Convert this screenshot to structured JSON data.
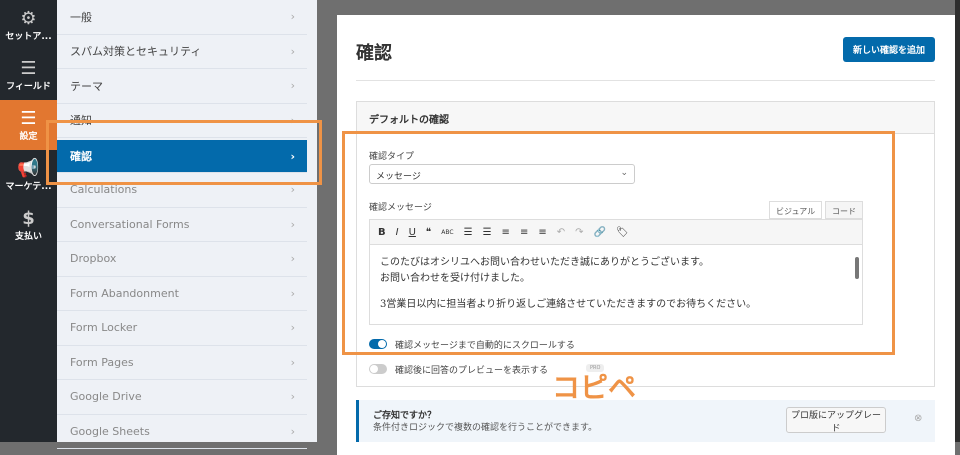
{
  "nav": [
    {
      "label": "セットア...",
      "icon": "gear-icon"
    },
    {
      "label": "フィールド",
      "icon": "fields-icon"
    },
    {
      "label": "設定",
      "icon": "sliders-icon",
      "active": true
    },
    {
      "label": "マーケテ...",
      "icon": "megaphone-icon"
    },
    {
      "label": "支払い",
      "icon": "dollar-icon"
    }
  ],
  "submenu": [
    "一般",
    "スパム対策とセキュリティ",
    "テーマ",
    "通知",
    "確認",
    "Calculations",
    "Conversational Forms",
    "Dropbox",
    "Form Abandonment",
    "Form Locker",
    "Form Pages",
    "Google Drive",
    "Google Sheets"
  ],
  "submenu_active": "確認",
  "main": {
    "title": "確認",
    "add_button": "新しい確認を追加",
    "box_title": "デフォルトの確認",
    "type_label": "確認タイプ",
    "type_value": "メッセージ",
    "message_label": "確認メッセージ",
    "tab_visual": "ビジュアル",
    "tab_code": "コード",
    "message_lines": [
      "このたびはオシリユへお問い合わせいただき誠にありがとうございます。",
      "お問い合わせを受け付けました。",
      "3営業日以内に担当者より折り返しご連絡させていただきますのでお待ちください。"
    ],
    "toggle1": {
      "label": "確認メッセージまで自動的にスクロールする",
      "on": true
    },
    "toggle2": {
      "label": "確認後に回答のプレビューを表示する",
      "on": false,
      "badge": "PRO"
    }
  },
  "notice": {
    "title": "ご存知ですか？",
    "text": "条件付きロジックで複数の確認を行うことができます。",
    "button": "プロ版にアップグレード"
  },
  "annotation": "コピペ",
  "colors": {
    "accent": "#036aab",
    "orange": "#e27730",
    "highlight": "#ef9346"
  }
}
